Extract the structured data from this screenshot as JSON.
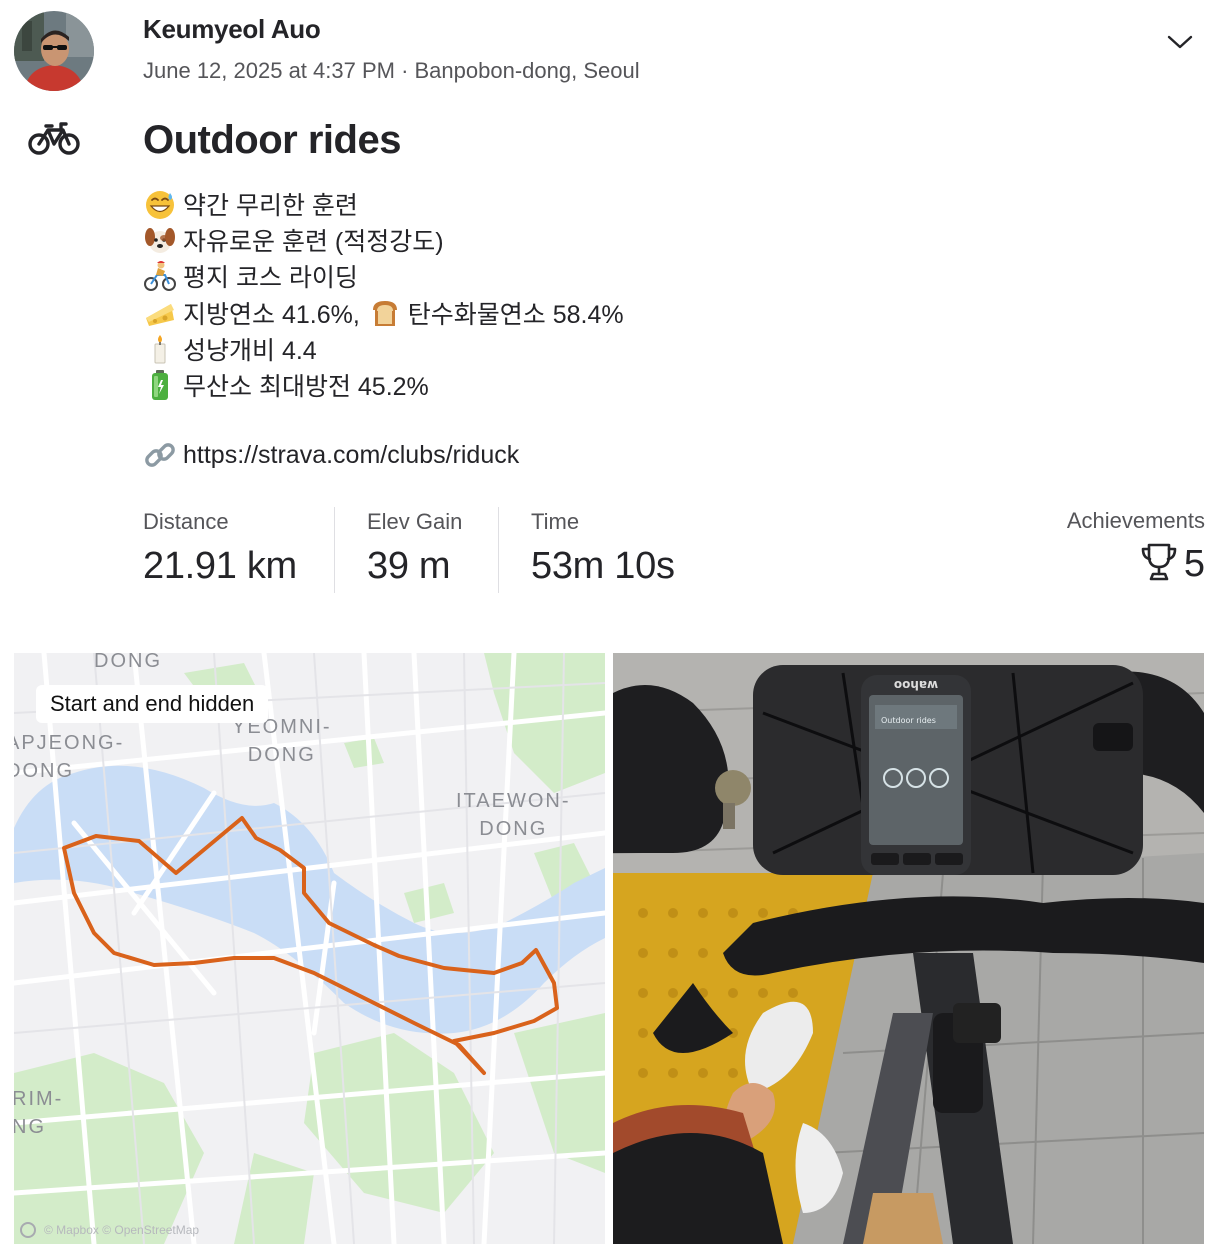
{
  "post": {
    "author": "Keumyeol Auo",
    "meta": "June 12, 2025 at 4:37 PM · Banpobon-dong, Seoul",
    "menu_icon": "chevron-down-icon",
    "sport_icon": "bike-icon",
    "title": "Outdoor rides"
  },
  "description": [
    {
      "icon": "sweat-smile-emoji",
      "text": "약간 무리한 훈련"
    },
    {
      "icon": "dog-face-emoji",
      "text": "자유로운 훈련 (적정강도)"
    },
    {
      "icon": "cyclist-emoji",
      "text": "평지 코스 라이딩"
    },
    {
      "icon": "cheese-emoji",
      "text": "지방연소 41.6%,",
      "icon2": "bread-emoji",
      "text2": "탄수화물연소 58.4%"
    },
    {
      "icon": "candle-emoji",
      "text": "성냥개비 4.4"
    },
    {
      "icon": "battery-emoji",
      "text": "무산소 최대방전 45.2%"
    }
  ],
  "link": {
    "icon": "link-icon",
    "text": "https://strava.com/clubs/riduck"
  },
  "stats": [
    {
      "label": "Distance",
      "value": "21.91 km"
    },
    {
      "label": "Elev Gain",
      "value": "39 m"
    },
    {
      "label": "Time",
      "value": "53m 10s"
    }
  ],
  "achievements": {
    "label": "Achievements",
    "value": "5",
    "icon": "trophy-icon"
  },
  "map": {
    "badge": "Start and end hidden",
    "labels": [
      "DONG",
      "YEOMNI-\nDONG",
      "APJEONG-\nDONG",
      "ITAEWON-\nDONG",
      "RIM-\nNG"
    ],
    "attribution": "© Mapbox © OpenStreetMap",
    "route_color": "#d9621b",
    "river_color": "#c9ddf6"
  },
  "photo": {
    "device_brand": "wahoo",
    "screen_title": "Outdoor rides"
  },
  "colors": {
    "text": "#242428",
    "muted": "#555559",
    "divider": "#dfdfe3"
  }
}
